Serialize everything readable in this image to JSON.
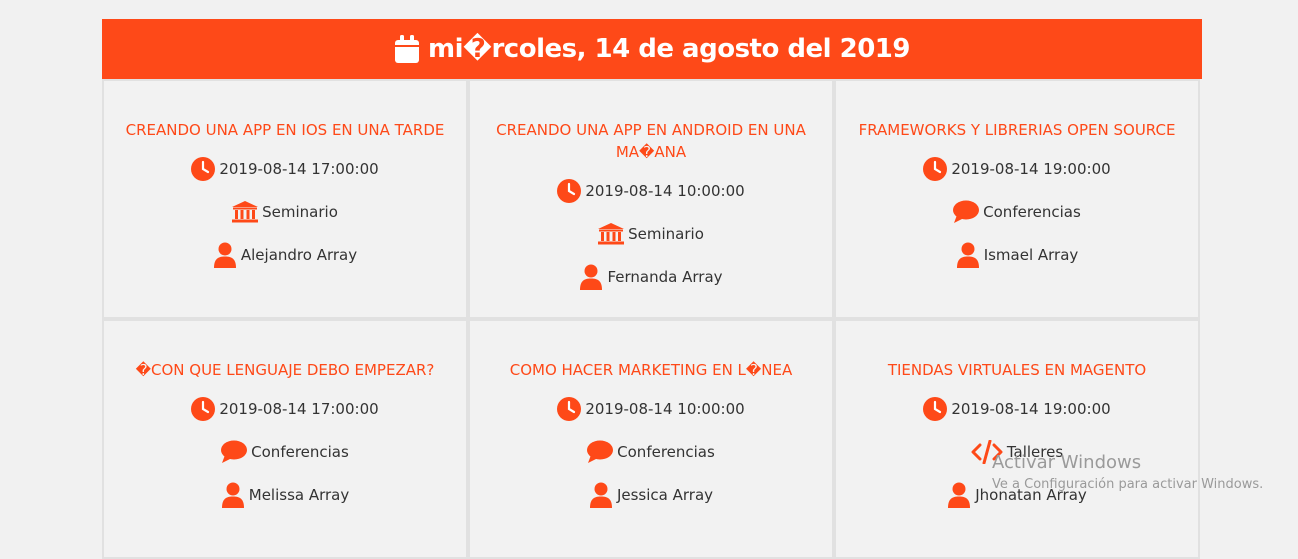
{
  "header": {
    "date": "mi�rcoles, 14 de agosto del 2019",
    "icon": "calendar-icon"
  },
  "events": [
    {
      "title": "CREANDO UNA APP EN IOS EN UNA TARDE",
      "datetime": "2019-08-14 17:00:00",
      "category": "Seminario",
      "category_icon": "university-icon",
      "speaker": "Alejandro Array"
    },
    {
      "title": "CREANDO UNA APP EN ANDROID EN UNA MA�ANA",
      "datetime": "2019-08-14 10:00:00",
      "category": "Seminario",
      "category_icon": "university-icon",
      "speaker": "Fernanda Array"
    },
    {
      "title": "FRAMEWORKS Y LIBRERIAS OPEN SOURCE",
      "datetime": "2019-08-14 19:00:00",
      "category": "Conferencias",
      "category_icon": "comment-icon",
      "speaker": "Ismael Array"
    },
    {
      "title": "�CON QUE LENGUAJE DEBO EMPEZAR?",
      "datetime": "2019-08-14 17:00:00",
      "category": "Conferencias",
      "category_icon": "comment-icon",
      "speaker": "Melissa Array"
    },
    {
      "title": "COMO HACER MARKETING EN L�NEA",
      "datetime": "2019-08-14 10:00:00",
      "category": "Conferencias",
      "category_icon": "comment-icon",
      "speaker": "Jessica Array"
    },
    {
      "title": "TIENDAS VIRTUALES EN MAGENTO",
      "datetime": "2019-08-14 19:00:00",
      "category": "Talleres",
      "category_icon": "code-icon",
      "speaker": "Jhonatan Array"
    }
  ],
  "watermark": {
    "line1": "Activar Windows",
    "line2": "Ve a Configuración para activar Windows."
  },
  "colors": {
    "accent": "#fe4918",
    "card_bg": "#f2f2f2",
    "border": "#e1e1e1"
  }
}
